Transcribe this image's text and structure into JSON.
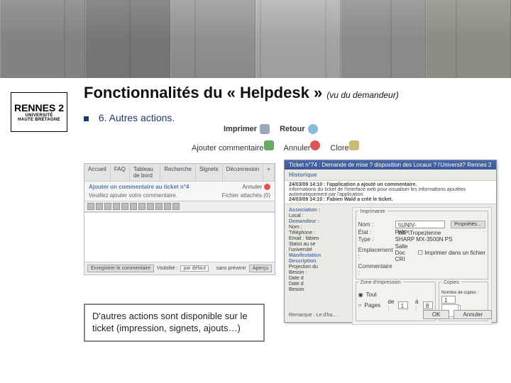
{
  "banner": {
    "alt": "bandeau photos noir et blanc"
  },
  "logo": {
    "line1": "RENNES",
    "line2": "2",
    "line3": "UNIVERSITÉ",
    "line4": "HAUTE BRETAGNE"
  },
  "title": {
    "main": "Fonctionnalités du « Helpdesk »",
    "sub": "(vu du demandeur)"
  },
  "bullet": {
    "text": "6. Autres actions."
  },
  "top_actions": {
    "print": "Imprimer",
    "back": "Retour"
  },
  "mid_actions": {
    "add": "Ajouter commentaire",
    "cancel": "Annuler",
    "close": "Clore"
  },
  "editor": {
    "tabs": [
      "Accueil",
      "FAQ",
      "Tableau de bord",
      "Recherche",
      "Signets",
      "Déconnexion"
    ],
    "heading": "Ajouter un commentaire au ticket n°4",
    "cancel": "Annuler",
    "prompt": "Veuillez ajouter votre commentaire.",
    "attach": "Fichier attachés (0)",
    "save": "Enregistrer le commentaire",
    "vis_label": "Visibilité :",
    "vis_value": "par défaut",
    "noalert": "sans prévenir",
    "preview": "Aperçu"
  },
  "dialog": {
    "title": "Ticket n°74 : Demande de mise ? disposition des Locaux ? l'Universit? Rennes 2",
    "histo": "Historique",
    "log1": "24/03/09 14:10 : l'application a ajouté un commentaire.",
    "log1b": "Informations du ticket de l'interface web pour visualiser les informations ajoutées automatiquement par l'application.",
    "log2": "24/03/09 14:10 : Fabien Wald a créé le ticket.",
    "left_sections": {
      "assoc": "Association :",
      "assoc_items": [
        "Local :"
      ],
      "demandeur": "Demandeur :",
      "demandeur_items": [
        "Nom :",
        "Téléphone :",
        "Email : fabien",
        "Statut au se",
        "l'université"
      ],
      "manif": "Manifestation",
      "desc": "Description",
      "desc_items": [
        "Projection du",
        "Besoin :",
        "Date d",
        "Date d",
        "Besoin"
      ]
    },
    "panel": {
      "title": "Imprimante",
      "nom_label": "Nom :",
      "nom_value": "\\\\UNIV-IMP\\Tropezienne",
      "etat_label": "État :",
      "etat_value": "Prêt",
      "type_label": "Type :",
      "type_value": "SHARP MX-3500N PS",
      "emp_label": "Emplacement :",
      "emp_value": "Salle Doc CRI",
      "com_label": "Commentaire :",
      "prop_btn": "Propriétés…",
      "file_chk": "Imprimer dans un fichier",
      "zone_title": "Zone d'impression",
      "zone_all": "Tout",
      "zone_pages": "Pages",
      "zone_from": "de :",
      "zone_from_v": "1",
      "zone_to": "à :",
      "zone_to_v": "8",
      "copies_title": "Copies",
      "copies_label": "Nombre de copies :",
      "copies_value": "1",
      "remark": "Remarque : Le d'ha…",
      "ok": "OK",
      "cancel": "Annuler"
    }
  },
  "caption": "D'autres actions sont disponible sur le ticket (impression, signets, ajouts…)"
}
